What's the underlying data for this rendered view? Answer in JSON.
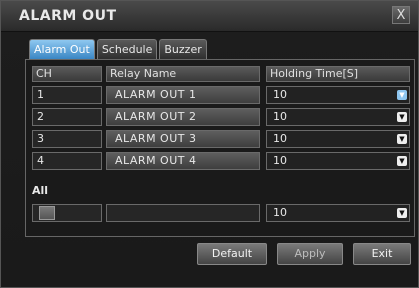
{
  "window": {
    "title": "ALARM OUT",
    "close_label": "X"
  },
  "tabs": [
    {
      "label": "Alarm Out",
      "active": true
    },
    {
      "label": "Schedule",
      "active": false
    },
    {
      "label": "Buzzer",
      "active": false
    }
  ],
  "table": {
    "headers": {
      "ch": "CH",
      "relay": "Relay Name",
      "holding": "Holding Time[S]"
    },
    "rows": [
      {
        "ch": "1",
        "relay": "ALARM OUT 1",
        "holding": "10"
      },
      {
        "ch": "2",
        "relay": "ALARM OUT 2",
        "holding": "10"
      },
      {
        "ch": "3",
        "relay": "ALARM OUT 3",
        "holding": "10"
      },
      {
        "ch": "4",
        "relay": "ALARM OUT 4",
        "holding": "10"
      }
    ]
  },
  "all": {
    "label": "All",
    "holding": "10"
  },
  "buttons": {
    "default": "Default",
    "apply": "Apply",
    "exit": "Exit"
  },
  "colors": {
    "accent": "#5aa6e0",
    "background": "#1a1a1a"
  },
  "icons": {
    "dropdown": "chevron-down-icon",
    "close": "close-icon"
  }
}
